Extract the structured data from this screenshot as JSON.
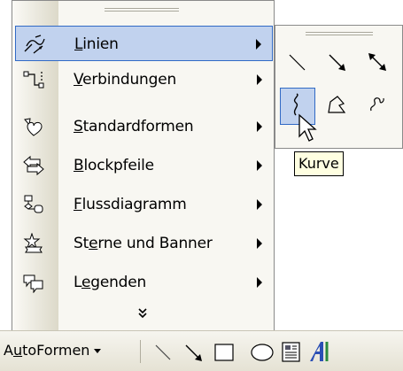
{
  "menu": {
    "items": [
      {
        "pre": "",
        "key": "L",
        "post": "inien",
        "icon": "lines-icon",
        "highlighted": true
      },
      {
        "pre": "",
        "key": "V",
        "post": "erbindungen",
        "icon": "connectors-icon"
      },
      {
        "pre": "",
        "key": "S",
        "post": "tandardformen",
        "icon": "basic-shapes-icon"
      },
      {
        "pre": "",
        "key": "B",
        "post": "lockpfeile",
        "icon": "block-arrows-icon"
      },
      {
        "pre": "",
        "key": "F",
        "post": "lussdiagramm",
        "icon": "flowchart-icon"
      },
      {
        "pre": "St",
        "key": "e",
        "post": "rne und Banner",
        "icon": "stars-banners-icon"
      },
      {
        "pre": "L",
        "key": "e",
        "post": "genden",
        "icon": "callouts-icon"
      }
    ],
    "more_icon": "expand-more-icon"
  },
  "submenu": {
    "tools": [
      "line-icon",
      "arrow-icon",
      "double-arrow-icon",
      "curve-icon",
      "freeform-icon",
      "scribble-icon"
    ],
    "selected_tool": "curve-icon"
  },
  "tooltip": {
    "text": "Kurve"
  },
  "toolbar": {
    "autoformen_pre": "A",
    "autoformen_key": "u",
    "autoformen_post": "toFormen",
    "tools": [
      "line-icon",
      "arrow-icon",
      "rectangle-icon",
      "oval-icon",
      "textbox-icon",
      "wordart-icon"
    ]
  },
  "colors": {
    "highlight": "#c1d2ee",
    "highlight_border": "#316ac5",
    "tooltip_bg": "#ffffe1",
    "wordart": "#2b4fb5"
  }
}
